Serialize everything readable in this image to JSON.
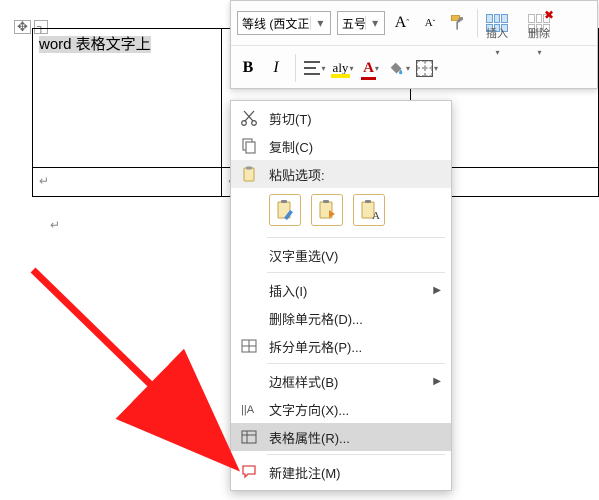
{
  "document": {
    "cell_text": "word 表格文字上",
    "paragraph_mark": "↵"
  },
  "mini_toolbar": {
    "font_combo": "等线 (西文正",
    "size_combo": "五号",
    "grow_font": "A",
    "shrink_font": "A",
    "insert_label": "插入",
    "delete_label": "删除",
    "bold": "B",
    "italic": "I",
    "highlight_A": "aly",
    "fontcolor_A": "A"
  },
  "context_menu": {
    "cut": "剪切(T)",
    "copy": "复制(C)",
    "paste_header": "粘贴选项:",
    "reconvert": "汉字重选(V)",
    "insert": "插入(I)",
    "delete_cells": "删除单元格(D)...",
    "split_cells": "拆分单元格(P)...",
    "border_styles": "边框样式(B)",
    "text_direction": "文字方向(X)...",
    "table_properties": "表格属性(R)...",
    "new_comment": "新建批注(M)"
  }
}
